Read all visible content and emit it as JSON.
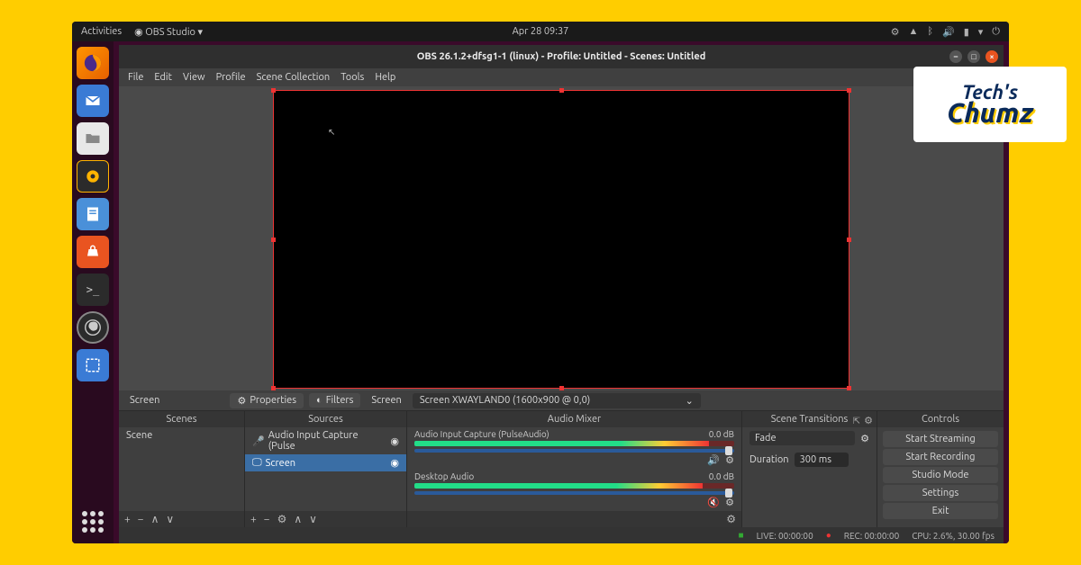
{
  "topbar": {
    "activities": "Activities",
    "app_menu": "OBS Studio",
    "datetime": "Apr 28  09:37"
  },
  "dock": {
    "items": [
      "firefox",
      "thunderbird",
      "files",
      "rhythmbox",
      "writer",
      "software",
      "terminal",
      "obs",
      "screenshot"
    ]
  },
  "window": {
    "title": "OBS 26.1.2+dfsg1-1 (linux) - Profile: Untitled - Scenes: Untitled",
    "menubar": [
      "File",
      "Edit",
      "View",
      "Profile",
      "Scene Collection",
      "Tools",
      "Help"
    ]
  },
  "infobar": {
    "screen_label": "Screen",
    "properties": "Properties",
    "filters": "Filters",
    "screen_label2": "Screen",
    "source_selected": "Screen XWAYLAND0 (1600x900 @ 0,0)"
  },
  "panels": {
    "scenes": {
      "title": "Scenes",
      "items": [
        "Scene"
      ]
    },
    "sources": {
      "title": "Sources",
      "items": [
        {
          "name": "Audio Input Capture (Pulse",
          "icon": "mic",
          "selected": false
        },
        {
          "name": "Screen",
          "icon": "display",
          "selected": true
        }
      ]
    },
    "mixer": {
      "title": "Audio Mixer",
      "tracks": [
        {
          "name": "Audio Input Capture (PulseAudio)",
          "db": "0.0 dB",
          "level": 0.92,
          "muted": false
        },
        {
          "name": "Desktop Audio",
          "db": "0.0 dB",
          "level": 0.9,
          "muted": true
        }
      ]
    },
    "transitions": {
      "title": "Scene Transitions",
      "type": "Fade",
      "duration_label": "Duration",
      "duration": "300 ms"
    },
    "controls": {
      "title": "Controls",
      "buttons": [
        "Start Streaming",
        "Start Recording",
        "Studio Mode",
        "Settings",
        "Exit"
      ]
    }
  },
  "statusbar": {
    "live": "LIVE: 00:00:00",
    "rec": "REC: 00:00:00",
    "cpu": "CPU: 2.6%, 30.00 fps"
  },
  "logo": {
    "l1": "Tech's",
    "l2": "Chumz"
  }
}
